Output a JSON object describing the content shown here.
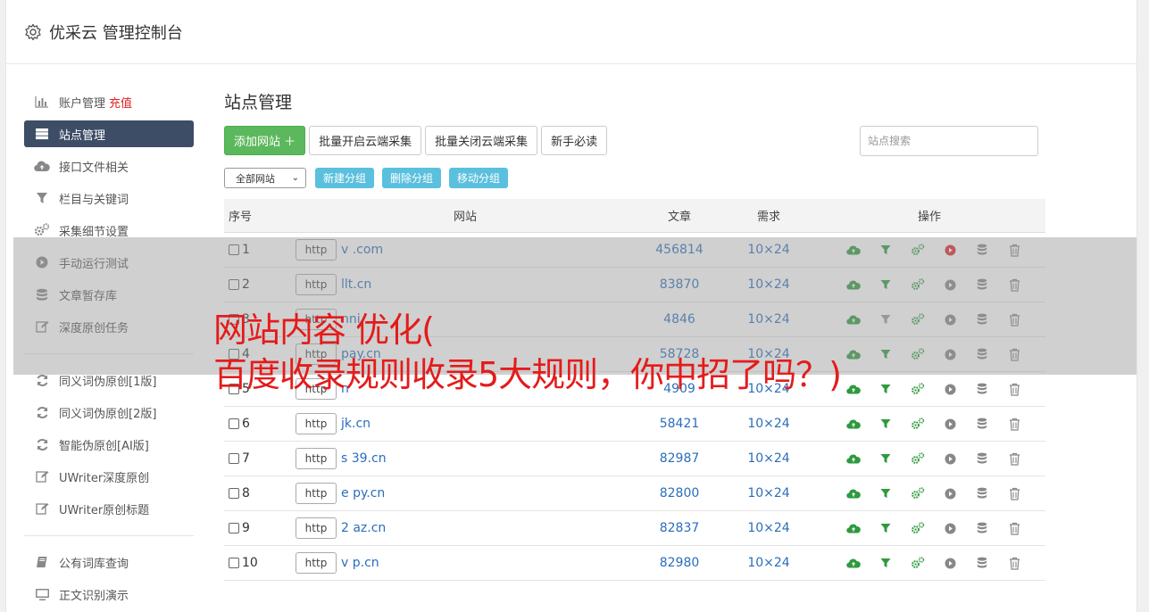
{
  "header": {
    "title": "优采云 管理控制台"
  },
  "sidebar": {
    "items": [
      {
        "label": "账户管理",
        "extra": "充值",
        "icon": "bar-chart-icon"
      },
      {
        "label": "站点管理",
        "icon": "server-icon",
        "active": true
      },
      {
        "label": "接口文件相关",
        "icon": "cloud-upload-icon"
      },
      {
        "label": "栏目与关键词",
        "icon": "filter-icon"
      },
      {
        "label": "采集细节设置",
        "icon": "cogs-icon"
      },
      {
        "label": "手动运行测试",
        "icon": "play-icon"
      },
      {
        "label": "文章暂存库",
        "icon": "database-icon"
      },
      {
        "label": "深度原创任务",
        "icon": "edit-icon"
      }
    ],
    "items2": [
      {
        "label": "同义词伪原创[1版]",
        "icon": "refresh-icon"
      },
      {
        "label": "同义词伪原创[2版]",
        "icon": "refresh-icon"
      },
      {
        "label": "智能伪原创[AI版]",
        "icon": "refresh-icon"
      },
      {
        "label": "UWriter深度原创",
        "icon": "edit-icon"
      },
      {
        "label": "UWriter原创标题",
        "icon": "edit-icon"
      }
    ],
    "items3": [
      {
        "label": "公有词库查询",
        "icon": "book-icon"
      },
      {
        "label": "正文识别演示",
        "icon": "monitor-icon"
      }
    ]
  },
  "main": {
    "title": "站点管理",
    "toolbar": {
      "add_site": "添加网站 ＋",
      "batch_open": "批量开启云端采集",
      "batch_close": "批量关闭云端采集",
      "newbie": "新手必读",
      "search_placeholder": "站点搜索"
    },
    "filter": {
      "group_select": "全部网站",
      "new_group": "新建分组",
      "delete_group": "删除分组",
      "move_group": "移动分组"
    },
    "table": {
      "headers": {
        "no": "序号",
        "site": "网站",
        "articles": "文章",
        "demand": "需求",
        "ops": "操作"
      },
      "rows": [
        {
          "no": "1",
          "http": "http",
          "domain": "v          .com",
          "articles": "456814",
          "demand": "10×24",
          "run_active": true
        },
        {
          "no": "2",
          "http": "http",
          "domain": "       llt.cn",
          "articles": "83870",
          "demand": "10×24"
        },
        {
          "no": "3",
          "http": "http",
          "domain": "      nni",
          "articles": "4846",
          "demand": "10×24",
          "faded": true
        },
        {
          "no": "4",
          "http": "http",
          "domain": "       pay.cn",
          "articles": "58728",
          "demand": "10×24"
        },
        {
          "no": "5",
          "http": "http",
          "domain": "          n",
          "articles": "4909",
          "demand": "10×24"
        },
        {
          "no": "6",
          "http": "http",
          "domain": "      jk.cn",
          "articles": "58421",
          "demand": "10×24"
        },
        {
          "no": "7",
          "http": "http",
          "domain": "s    39.cn",
          "articles": "82987",
          "demand": "10×24"
        },
        {
          "no": "8",
          "http": "http",
          "domain": "e      py.cn",
          "articles": "82800",
          "demand": "10×24"
        },
        {
          "no": "9",
          "http": "http",
          "domain": "2      az.cn",
          "articles": "82837",
          "demand": "10×24"
        },
        {
          "no": "10",
          "http": "http",
          "domain": "v      p.cn",
          "articles": "82980",
          "demand": "10×24"
        }
      ]
    }
  },
  "overlay": {
    "line1": "网站内容 优化(",
    "line2": "百度收录规则收录5大规则，你中招了吗？)"
  },
  "colors": {
    "accent_green": "#5cb85c",
    "info_blue": "#5bc0de",
    "nav_active": "#3d4d66",
    "headline_red": "#e51b1b"
  }
}
